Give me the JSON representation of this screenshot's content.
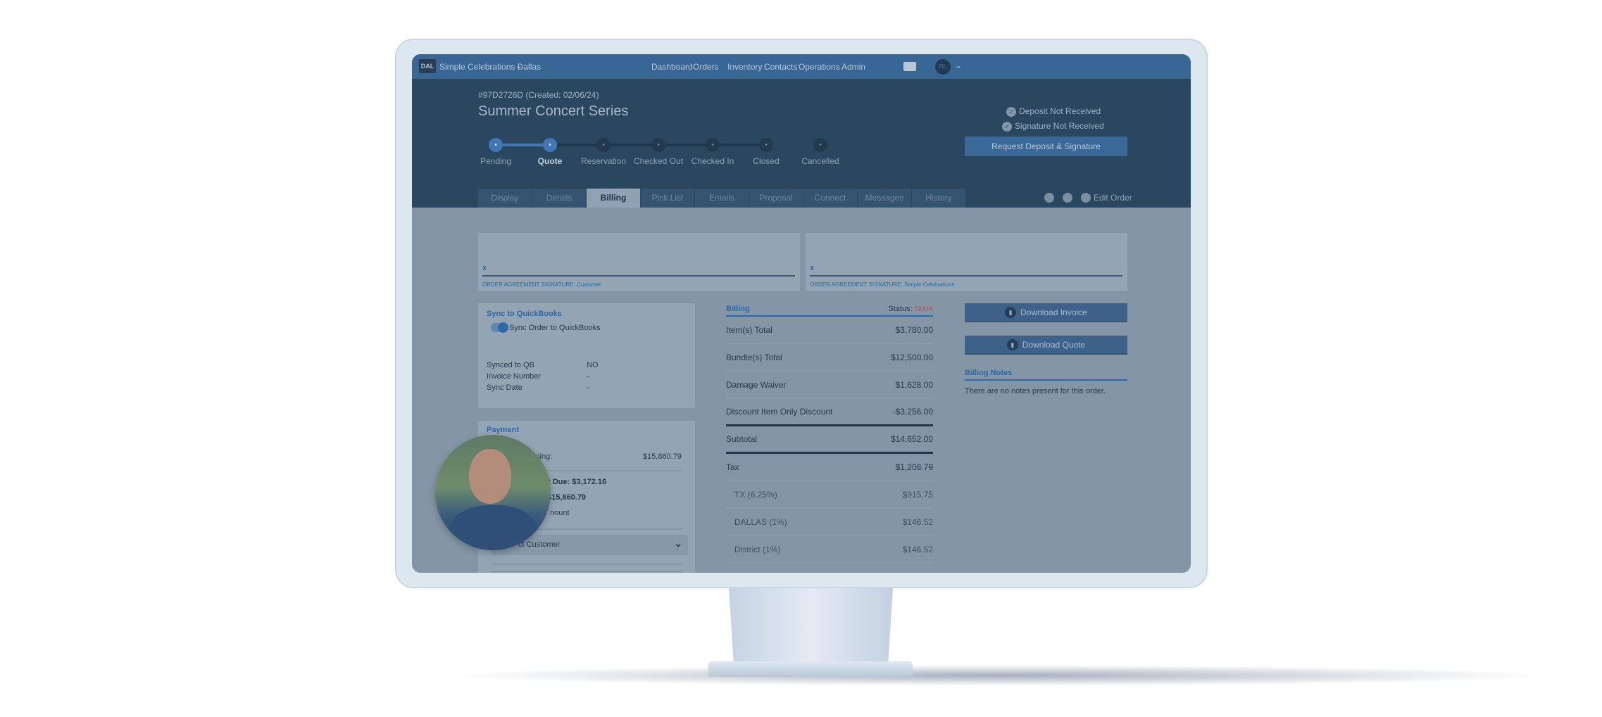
{
  "nav": {
    "org_badge": "DAL",
    "org_name": "Simple Celebrations Dallas",
    "links": [
      "Dashboard",
      "Orders",
      "Inventory",
      "Contacts",
      "Operations",
      "Admin"
    ],
    "user_initials": "DL"
  },
  "order": {
    "id_line": "#97D2726D (Created: 02/06/24)",
    "title": "Summer Concert Series",
    "steps": [
      "Pending",
      "Quote",
      "Reservation",
      "Checked Out",
      "Checked In",
      "Closed",
      "Cancelled"
    ],
    "active_steps": 2,
    "deposit_status": "Deposit Not Received",
    "signature_status": "Signature Not Received",
    "request_button": "Request Deposit & Signature"
  },
  "tabs": [
    "Display",
    "Details",
    "Billing",
    "Pick List",
    "Emails",
    "Proposal",
    "Connect",
    "Messages",
    "History"
  ],
  "active_tab": "Billing",
  "edit_order": "Edit Order",
  "signatures": [
    {
      "x": "x",
      "label": "ORDER AGREEMENT SIGNATURE: Customer"
    },
    {
      "x": "x",
      "label": "ORDER AGREEMENT SIGNATURE: Simple Celebrations"
    }
  ],
  "quickbooks": {
    "title": "Sync to QuickBooks",
    "toggle_label": "Sync Order to QuickBooks",
    "toggle_on": true,
    "rows": [
      [
        "Synced to QB",
        "NO"
      ],
      [
        "Invoice Number",
        "-"
      ],
      [
        "Sync Date",
        "-"
      ]
    ]
  },
  "payment": {
    "title": "Payment",
    "remaining_label": "ining:",
    "remaining_value": "$15,860.79",
    "due_line": "t Due: $3,172.16",
    "total_line": "$15,860.79",
    "amount_line": "nount",
    "select_value": "ct Customer"
  },
  "billing": {
    "title": "Billing",
    "status_label": "Status:",
    "status_value": "None",
    "status_color": "#b5544c",
    "rows": [
      [
        "Item(s) Total",
        "$3,780.00"
      ],
      [
        "Bundle(s) Total",
        "$12,500.00"
      ],
      [
        "Damage Waiver",
        "$1,628.00"
      ],
      [
        "Discount Item Only Discount",
        "-$3,256.00"
      ],
      [
        "Subtotal",
        "$14,652.00"
      ],
      [
        "Tax",
        "$1,208.79"
      ],
      [
        "TX (6.25%)",
        "$915.75"
      ],
      [
        "DALLAS (1%)",
        "$146.52"
      ],
      [
        "District (1%)",
        "$146.52"
      ]
    ]
  },
  "actions": {
    "download_invoice": "Download Invoice",
    "download_quote": "Download Quote",
    "notes_title": "Billing Notes",
    "notes_text": "There are no notes present for this order."
  }
}
